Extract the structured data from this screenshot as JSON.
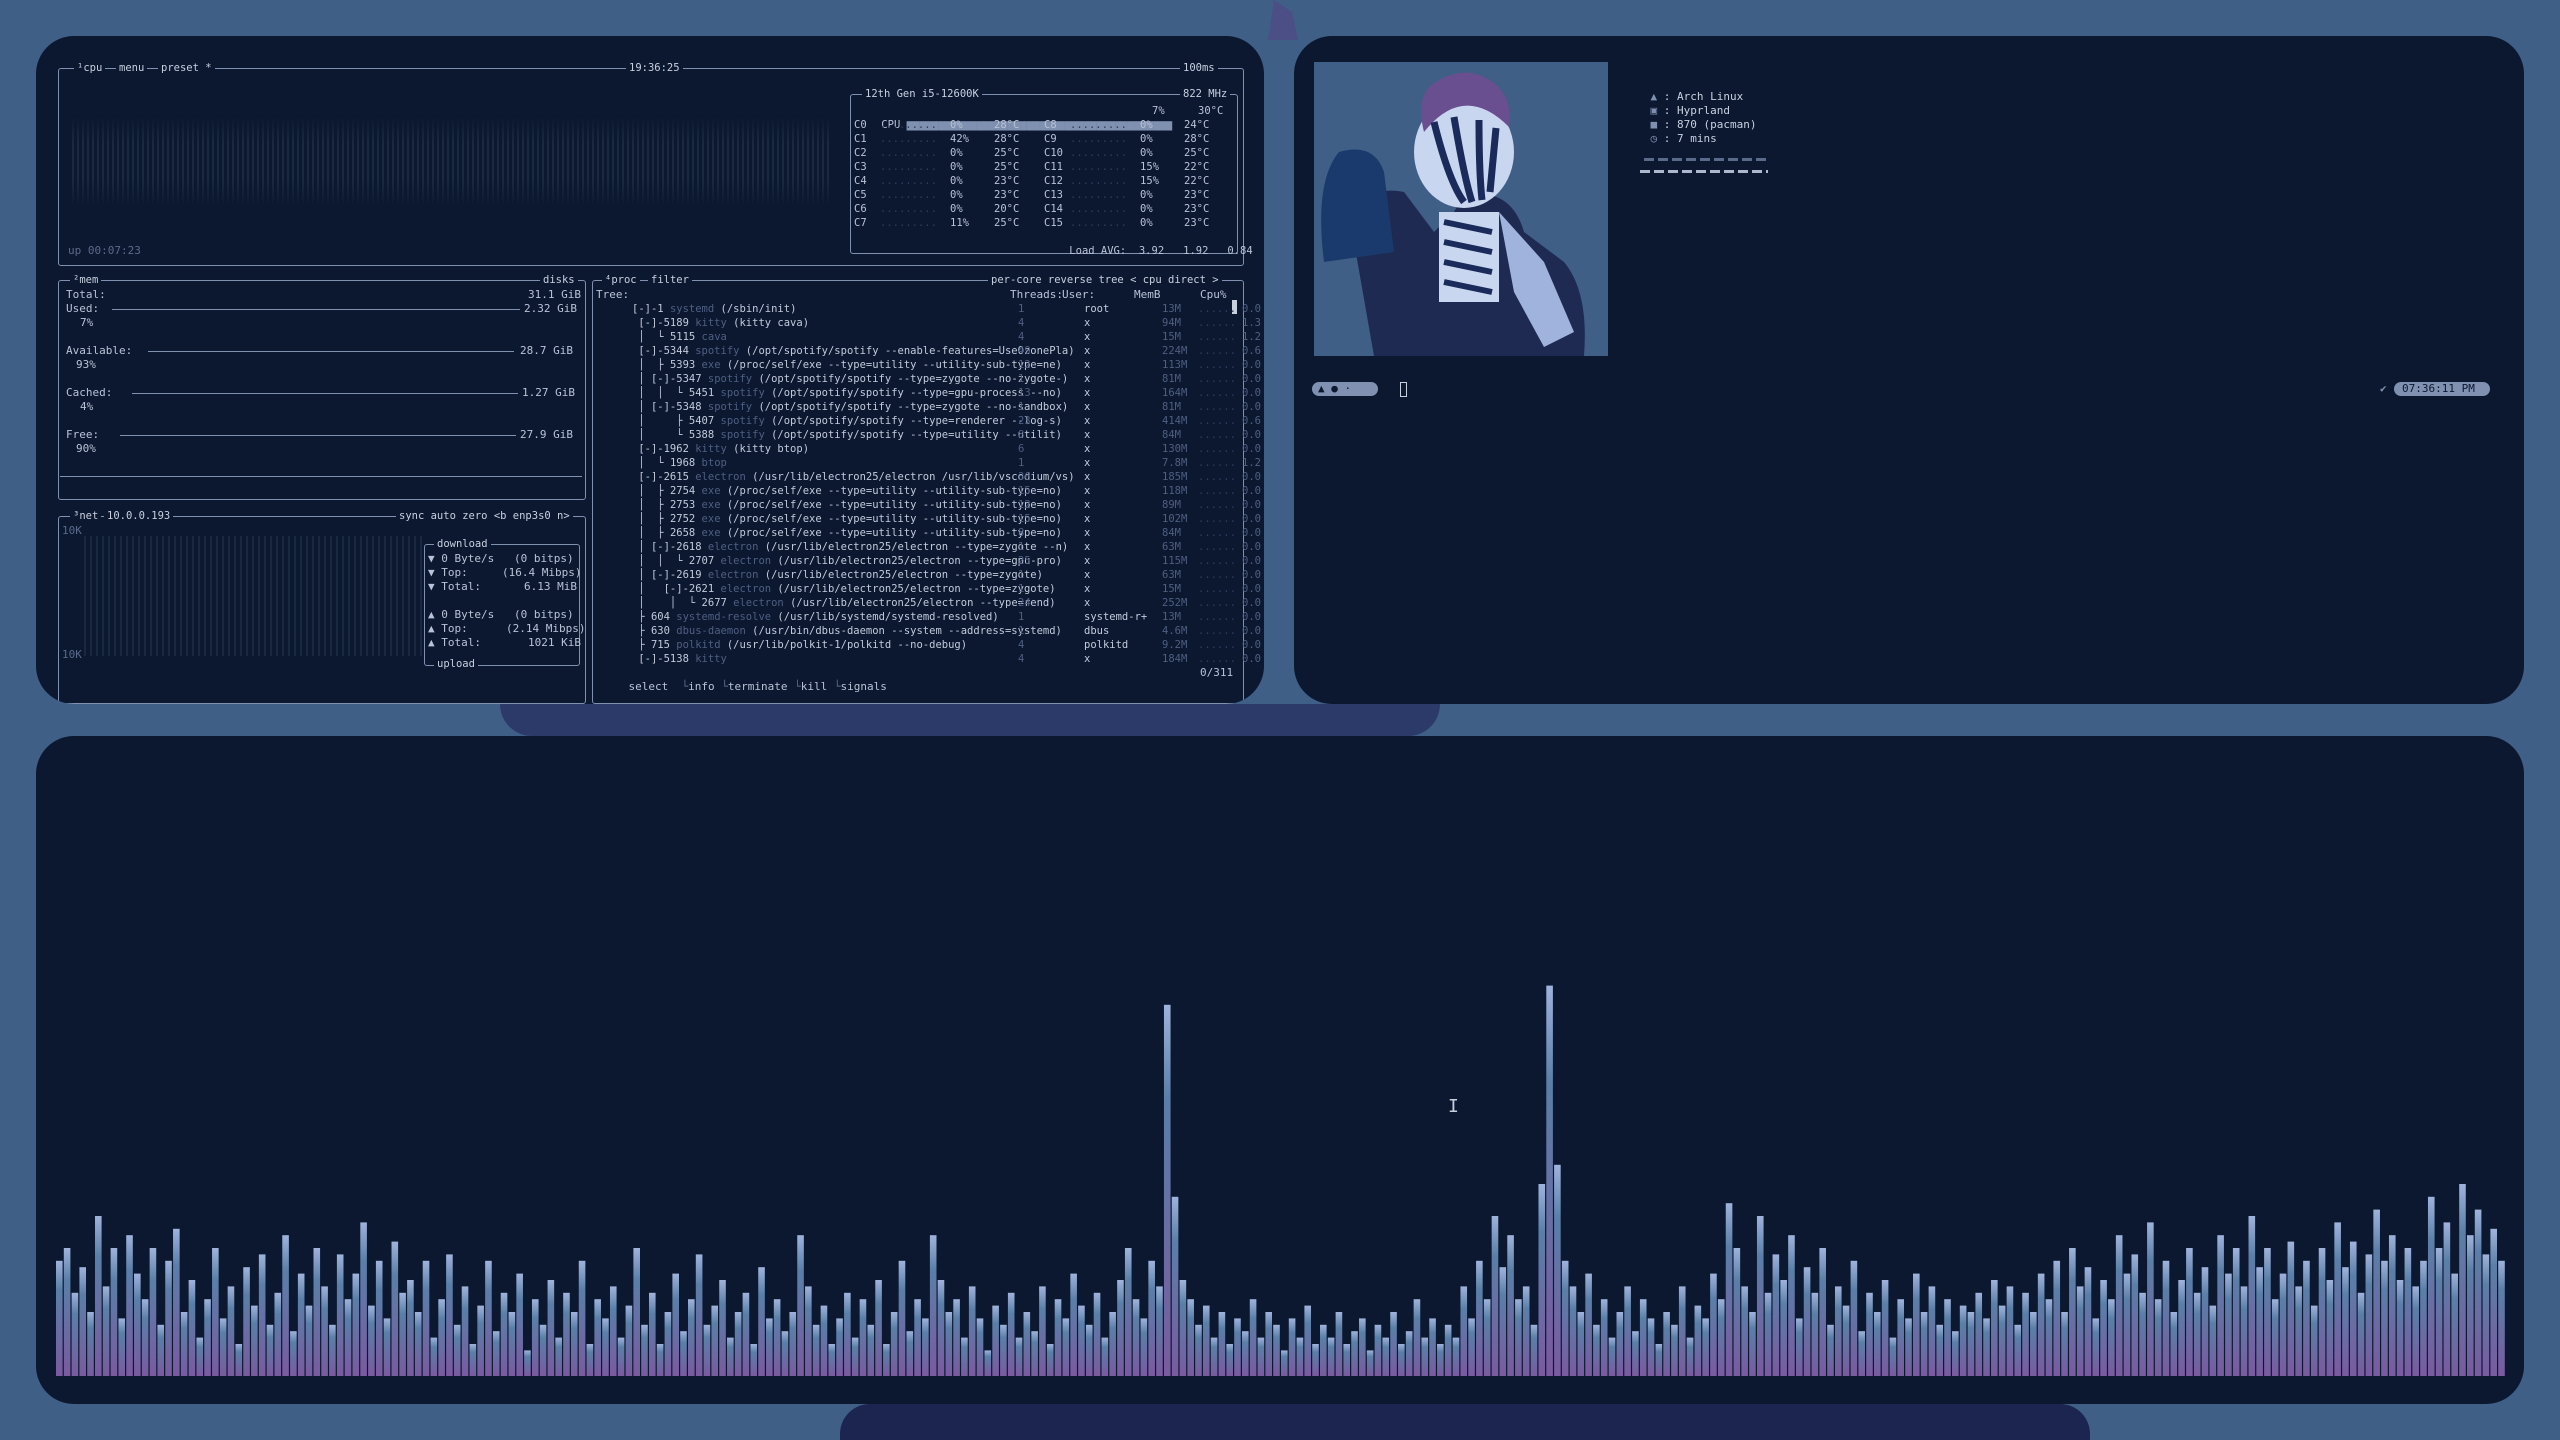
{
  "btop": {
    "cpu_box": {
      "tab_cpu": "¹cpu",
      "tab_menu": "menu",
      "tab_preset": "preset *",
      "clock": "19:36:25",
      "interval": "100ms",
      "uptime": "up 00:07:23"
    },
    "cpu_panel": {
      "model": "12th Gen i5-12600K",
      "freq": "822 MHz",
      "total_label": "CPU",
      "total_pct": "7%",
      "total_temp": "30°C",
      "load_avg_label": "Load AVG:",
      "load_avg": [
        "3.92",
        "1.92",
        "0.84"
      ],
      "cores_left": [
        {
          "name": "C0",
          "pct": "0%",
          "temp": "28°C"
        },
        {
          "name": "C1",
          "pct": "42%",
          "temp": "28°C"
        },
        {
          "name": "C2",
          "pct": "0%",
          "temp": "25°C"
        },
        {
          "name": "C3",
          "pct": "0%",
          "temp": "25°C"
        },
        {
          "name": "C4",
          "pct": "0%",
          "temp": "23°C"
        },
        {
          "name": "C5",
          "pct": "0%",
          "temp": "23°C"
        },
        {
          "name": "C6",
          "pct": "0%",
          "temp": "20°C"
        },
        {
          "name": "C7",
          "pct": "11%",
          "temp": "25°C"
        }
      ],
      "cores_right": [
        {
          "name": "C8",
          "pct": "0%",
          "temp": "24°C"
        },
        {
          "name": "C9",
          "pct": "0%",
          "temp": "28°C"
        },
        {
          "name": "C10",
          "pct": "0%",
          "temp": "25°C"
        },
        {
          "name": "C11",
          "pct": "15%",
          "temp": "22°C"
        },
        {
          "name": "C12",
          "pct": "15%",
          "temp": "22°C"
        },
        {
          "name": "C13",
          "pct": "0%",
          "temp": "23°C"
        },
        {
          "name": "C14",
          "pct": "0%",
          "temp": "23°C"
        },
        {
          "name": "C15",
          "pct": "0%",
          "temp": "23°C"
        }
      ]
    },
    "mem_box": {
      "tab_mem": "²mem",
      "tab_disks": "disks",
      "total_label": "Total:",
      "total": "31.1 GiB",
      "used_label": "Used:",
      "used": "2.32 GiB",
      "used_pct": "7%",
      "available_label": "Available:",
      "available": "28.7 GiB",
      "available_pct": "93%",
      "cached_label": "Cached:",
      "cached": "1.27 GiB",
      "cached_pct": "4%",
      "free_label": "Free:",
      "free": "27.9 GiB",
      "free_pct": "90%"
    },
    "net_box": {
      "tab_net": "³net",
      "ip": "10.0.0.193",
      "tabs_right": "sync auto zero <b enp3s0 n>",
      "scale_top": "10K",
      "scale_bottom": "10K",
      "download_label": "download",
      "upload_label": "upload",
      "down_rate": "0 Byte/s",
      "down_rate_bits": "(0 bitps)",
      "down_top_label": "Top:",
      "down_top": "(16.4 Mibps)",
      "down_total_label": "Total:",
      "down_total": "6.13 MiB",
      "up_rate": "0 Byte/s",
      "up_rate_bits": "(0 bitps)",
      "up_top_label": "Top:",
      "up_top": "(2.14 Mibps)",
      "up_total_label": "Total:",
      "up_total": "1021 KiB"
    },
    "proc_box": {
      "tab_proc": "⁴proc",
      "tab_filter": "filter",
      "tabs_right": "per-core reverse tree < cpu direct >",
      "col_tree": "Tree:",
      "col_threads": "Threads:",
      "col_user": "User:",
      "col_memb": "MemB",
      "col_cpu": "Cpu%",
      "footer_select": "select",
      "footer_info": "info",
      "footer_terminate": "terminate",
      "footer_kill": "kill",
      "footer_signals": "signals",
      "footer_count": "0/311",
      "rows": [
        {
          "tree": "[-]-",
          "pid": "1",
          "name": "systemd",
          "cmd": "(/sbin/init)",
          "thr": "1",
          "user": "root",
          "mem": "13M",
          "cpu": "0.0"
        },
        {
          "tree": " [-]-",
          "pid": "5189",
          "name": "kitty",
          "cmd": "(kitty cava)",
          "thr": "4",
          "user": "x",
          "mem": "94M",
          "cpu": "1.3"
        },
        {
          "tree": " │  └ ",
          "pid": "5115",
          "name": "cava",
          "cmd": "",
          "thr": "4",
          "user": "x",
          "mem": "15M",
          "cpu": "1.2"
        },
        {
          "tree": " [-]-",
          "pid": "5344",
          "name": "spotify",
          "cmd": "(/opt/spotify/spotify --enable-features=UseOzonePla)",
          "thr": "49",
          "user": "x",
          "mem": "224M",
          "cpu": "0.6"
        },
        {
          "tree": " │  ├ ",
          "pid": "5393",
          "name": "exe",
          "cmd": "(/proc/self/exe --type=utility --utility-sub-type=ne)",
          "thr": "12",
          "user": "x",
          "mem": "113M",
          "cpu": "0.0"
        },
        {
          "tree": " │ [-]-",
          "pid": "5347",
          "name": "spotify",
          "cmd": "(/opt/spotify/spotify --type=zygote --no-zygote-)",
          "thr": "1",
          "user": "x",
          "mem": "81M",
          "cpu": "0.0"
        },
        {
          "tree": " │  │  └ ",
          "pid": "5451",
          "name": "spotify",
          "cmd": "(/opt/spotify/spotify --type=gpu-process --no)",
          "thr": "13",
          "user": "x",
          "mem": "164M",
          "cpu": "0.0"
        },
        {
          "tree": " │ [-]-",
          "pid": "5348",
          "name": "spotify",
          "cmd": "(/opt/spotify/spotify --type=zygote --no-sandbox)",
          "thr": "1",
          "user": "x",
          "mem": "81M",
          "cpu": "0.0"
        },
        {
          "tree": " │     ├ ",
          "pid": "5407",
          "name": "spotify",
          "cmd": "(/opt/spotify/spotify --type=renderer --log-s)",
          "thr": "23",
          "user": "x",
          "mem": "414M",
          "cpu": "0.6"
        },
        {
          "tree": " │     └ ",
          "pid": "5388",
          "name": "spotify",
          "cmd": "(/opt/spotify/spotify --type=utility --utilit)",
          "thr": "8",
          "user": "x",
          "mem": "84M",
          "cpu": "0.0"
        },
        {
          "tree": " [-]-",
          "pid": "1962",
          "name": "kitty",
          "cmd": "(kitty btop)",
          "thr": "6",
          "user": "x",
          "mem": "130M",
          "cpu": "0.0"
        },
        {
          "tree": " │  └ ",
          "pid": "1968",
          "name": "btop",
          "cmd": "",
          "thr": "1",
          "user": "x",
          "mem": "7.8M",
          "cpu": "1.2"
        },
        {
          "tree": " [-]-",
          "pid": "2615",
          "name": "electron",
          "cmd": "(/usr/lib/electron25/electron /usr/lib/vscodium/vs)",
          "thr": "36",
          "user": "x",
          "mem": "185M",
          "cpu": "0.0"
        },
        {
          "tree": " │  ├ ",
          "pid": "2754",
          "name": "exe",
          "cmd": "(/proc/self/exe --type=utility --utility-sub-type=no)",
          "thr": "15",
          "user": "x",
          "mem": "118M",
          "cpu": "0.0"
        },
        {
          "tree": " │  ├ ",
          "pid": "2753",
          "name": "exe",
          "cmd": "(/proc/self/exe --type=utility --utility-sub-type=no)",
          "thr": "12",
          "user": "x",
          "mem": "89M",
          "cpu": "0.0"
        },
        {
          "tree": " │  ├ ",
          "pid": "2752",
          "name": "exe",
          "cmd": "(/proc/self/exe --type=utility --utility-sub-type=no)",
          "thr": "15",
          "user": "x",
          "mem": "102M",
          "cpu": "0.0"
        },
        {
          "tree": " │  ├ ",
          "pid": "2658",
          "name": "exe",
          "cmd": "(/proc/self/exe --type=utility --utility-sub-type=no)",
          "thr": "8",
          "user": "x",
          "mem": "84M",
          "cpu": "0.0"
        },
        {
          "tree": " │ [-]-",
          "pid": "2618",
          "name": "electron",
          "cmd": "(/usr/lib/electron25/electron --type=zygote --n)",
          "thr": "1",
          "user": "x",
          "mem": "63M",
          "cpu": "0.0"
        },
        {
          "tree": " │  │  └ ",
          "pid": "2707",
          "name": "electron",
          "cmd": "(/usr/lib/electron25/electron --type=gpu-pro)",
          "thr": "25",
          "user": "x",
          "mem": "115M",
          "cpu": "0.0"
        },
        {
          "tree": " │ [-]-",
          "pid": "2619",
          "name": "electron",
          "cmd": "(/usr/lib/electron25/electron --type=zygote)",
          "thr": "1",
          "user": "x",
          "mem": "63M",
          "cpu": "0.0"
        },
        {
          "tree": " │   [-]-",
          "pid": "2621",
          "name": "electron",
          "cmd": "(/usr/lib/electron25/electron --type=zygote)",
          "thr": "1",
          "user": "x",
          "mem": "15M",
          "cpu": "0.0"
        },
        {
          "tree": " │    │  └ ",
          "pid": "2677",
          "name": "electron",
          "cmd": "(/usr/lib/electron25/electron --type=rend)",
          "thr": "24",
          "user": "x",
          "mem": "252M",
          "cpu": "0.0"
        },
        {
          "tree": " ├ ",
          "pid": "604",
          "name": "systemd-resolve",
          "cmd": "(/usr/lib/systemd/systemd-resolved)",
          "thr": "1",
          "user": "systemd-r+",
          "mem": "13M",
          "cpu": "0.0"
        },
        {
          "tree": " ├ ",
          "pid": "630",
          "name": "dbus-daemon",
          "cmd": "(/usr/bin/dbus-daemon --system --address=systemd)",
          "thr": "1",
          "user": "dbus",
          "mem": "4.6M",
          "cpu": "0.0"
        },
        {
          "tree": " ├ ",
          "pid": "715",
          "name": "polkitd",
          "cmd": "(/usr/lib/polkit-1/polkitd --no-debug)",
          "thr": "4",
          "user": "polkitd",
          "mem": "9.2M",
          "cpu": "0.0"
        },
        {
          "tree": " [-]-",
          "pid": "5138",
          "name": "kitty",
          "cmd": "",
          "thr": "4",
          "user": "x",
          "mem": "184M",
          "cpu": "0.0"
        }
      ]
    }
  },
  "fetch": {
    "os_icon": "arch-icon",
    "os": "Arch Linux",
    "wm": "Hyprland",
    "packages": "870 (pacman)",
    "uptime": "7 mins",
    "sep": ":"
  },
  "taskbar": {
    "workspaces": "▲ ● ·",
    "clock": "07:36:11 PM"
  },
  "colors": {
    "wallpaper": "#3f5f86",
    "window_bg": "#0c1830",
    "border": "#7f90b0",
    "cava_top": "#5a7fa8",
    "cava_bottom": "#7a5aa0"
  },
  "cava": {
    "values": [
      0.18,
      0.2,
      0.13,
      0.17,
      0.1,
      0.25,
      0.14,
      0.2,
      0.09,
      0.22,
      0.16,
      0.12,
      0.2,
      0.08,
      0.18,
      0.23,
      0.1,
      0.15,
      0.06,
      0.12,
      0.2,
      0.09,
      0.14,
      0.05,
      0.17,
      0.11,
      0.19,
      0.08,
      0.13,
      0.22,
      0.07,
      0.16,
      0.11,
      0.2,
      0.14,
      0.08,
      0.19,
      0.12,
      0.16,
      0.24,
      0.11,
      0.18,
      0.09,
      0.21,
      0.13,
      0.15,
      0.1,
      0.18,
      0.06,
      0.12,
      0.19,
      0.08,
      0.14,
      0.05,
      0.11,
      0.18,
      0.07,
      0.13,
      0.1,
      0.16,
      0.04,
      0.12,
      0.08,
      0.15,
      0.06,
      0.13,
      0.1,
      0.18,
      0.05,
      0.12,
      0.09,
      0.14,
      0.06,
      0.11,
      0.2,
      0.08,
      0.13,
      0.05,
      0.1,
      0.16,
      0.07,
      0.12,
      0.19,
      0.08,
      0.11,
      0.15,
      0.06,
      0.1,
      0.13,
      0.05,
      0.17,
      0.09,
      0.12,
      0.07,
      0.1,
      0.22,
      0.14,
      0.08,
      0.11,
      0.05,
      0.09,
      0.13,
      0.06,
      0.12,
      0.08,
      0.15,
      0.05,
      0.1,
      0.18,
      0.07,
      0.12,
      0.09,
      0.22,
      0.15,
      0.1,
      0.12,
      0.06,
      0.14,
      0.09,
      0.04,
      0.11,
      0.08,
      0.13,
      0.06,
      0.1,
      0.07,
      0.14,
      0.05,
      0.12,
      0.09,
      0.16,
      0.11,
      0.08,
      0.13,
      0.06,
      0.1,
      0.15,
      0.2,
      0.12,
      0.09,
      0.18,
      0.14,
      0.58,
      0.28,
      0.15,
      0.12,
      0.08,
      0.11,
      0.06,
      0.1,
      0.05,
      0.09,
      0.07,
      0.12,
      0.06,
      0.1,
      0.08,
      0.04,
      0.09,
      0.06,
      0.11,
      0.05,
      0.08,
      0.06,
      0.1,
      0.05,
      0.07,
      0.09,
      0.04,
      0.08,
      0.06,
      0.1,
      0.05,
      0.07,
      0.12,
      0.06,
      0.09,
      0.05,
      0.08,
      0.06,
      0.14,
      0.09,
      0.18,
      0.12,
      0.25,
      0.17,
      0.22,
      0.12,
      0.14,
      0.08,
      0.3,
      0.61,
      0.33,
      0.18,
      0.14,
      0.1,
      0.16,
      0.08,
      0.12,
      0.06,
      0.1,
      0.14,
      0.07,
      0.12,
      0.09,
      0.05,
      0.1,
      0.08,
      0.14,
      0.06,
      0.11,
      0.09,
      0.16,
      0.12,
      0.27,
      0.2,
      0.14,
      0.1,
      0.25,
      0.13,
      0.19,
      0.15,
      0.22,
      0.09,
      0.17,
      0.13,
      0.2,
      0.08,
      0.14,
      0.11,
      0.18,
      0.07,
      0.13,
      0.1,
      0.15,
      0.06,
      0.12,
      0.09,
      0.16,
      0.1,
      0.14,
      0.08,
      0.12,
      0.07,
      0.11,
      0.1,
      0.13,
      0.09,
      0.15,
      0.11,
      0.14,
      0.08,
      0.13,
      0.1,
      0.16,
      0.12,
      0.18,
      0.1,
      0.2,
      0.14,
      0.17,
      0.09,
      0.15,
      0.12,
      0.22,
      0.16,
      0.19,
      0.13,
      0.24,
      0.12,
      0.18,
      0.1,
      0.15,
      0.2,
      0.13,
      0.17,
      0.11,
      0.22,
      0.16,
      0.2,
      0.14,
      0.25,
      0.17,
      0.2,
      0.12,
      0.16,
      0.21,
      0.14,
      0.18,
      0.11,
      0.2,
      0.15,
      0.24,
      0.17,
      0.21,
      0.13,
      0.19,
      0.26,
      0.18,
      0.22,
      0.15,
      0.2,
      0.14,
      0.18,
      0.28,
      0.2,
      0.24,
      0.16,
      0.3,
      0.22,
      0.26,
      0.19,
      0.23,
      0.18
    ]
  }
}
